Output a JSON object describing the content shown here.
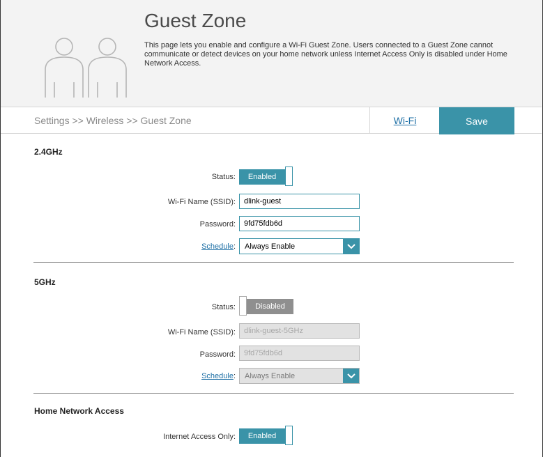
{
  "header": {
    "title": "Guest Zone",
    "description": "This page lets you enable and configure a Wi-Fi Guest Zone. Users connected to a Guest Zone cannot communicate or detect devices on your home network unless Internet Access Only is disabled under Home Network Access.",
    "icon": "two-users-icon"
  },
  "breadcrumb": "Settings >> Wireless >> Guest Zone",
  "tabs": {
    "wifi_label": "Wi-Fi",
    "save_label": "Save"
  },
  "colors": {
    "accent": "#3a93a8",
    "link": "#1d6fa5",
    "disabled": "#8f8f8f"
  },
  "band24": {
    "title": "2.4GHz",
    "status_label": "Status:",
    "status_value": "Enabled",
    "ssid_label": "Wi-Fi Name (SSID):",
    "ssid_value": "dlink-guest",
    "password_label": "Password:",
    "password_value": "9fd75fdb6d",
    "schedule_label": "Schedule",
    "schedule_value": "Always Enable"
  },
  "band5": {
    "title": "5GHz",
    "status_label": "Status:",
    "status_value": "Disabled",
    "ssid_label": "Wi-Fi Name (SSID):",
    "ssid_value": "dlink-guest-5GHz",
    "password_label": "Password:",
    "password_value": "9fd75fdb6d",
    "schedule_label": "Schedule",
    "schedule_value": "Always Enable"
  },
  "home_network": {
    "title": "Home Network Access",
    "internet_only_label": "Internet Access Only:",
    "internet_only_value": "Enabled"
  }
}
